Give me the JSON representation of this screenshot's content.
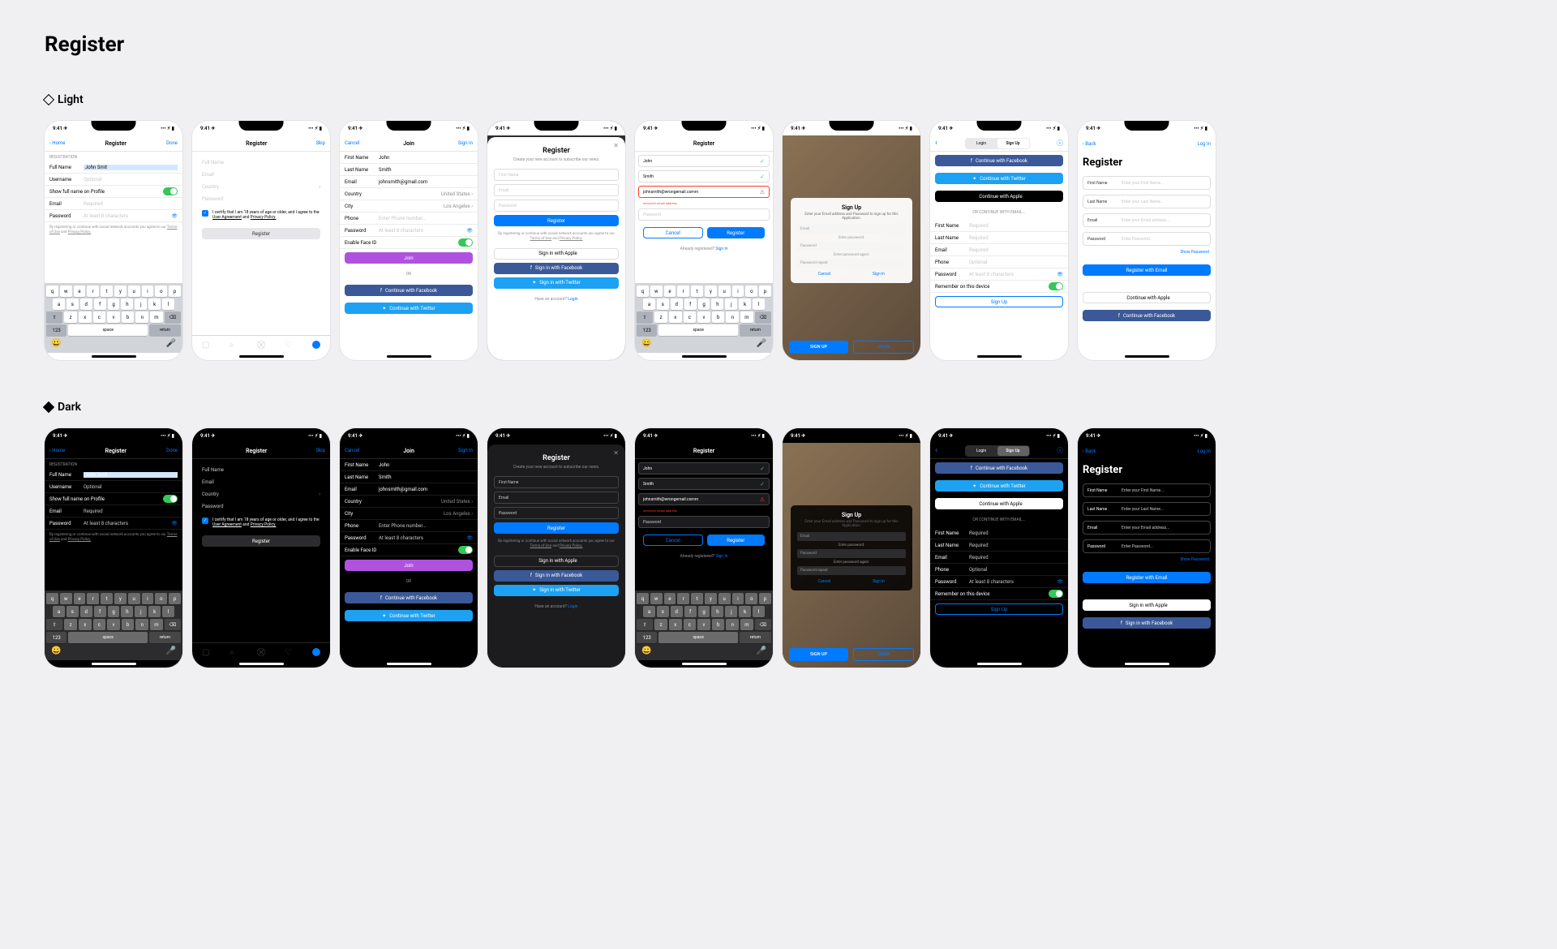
{
  "page_title": "Register",
  "variants": {
    "light": "Light",
    "dark": "Dark"
  },
  "status": {
    "time": "9:41"
  },
  "common": {
    "register": "Register",
    "done": "Done",
    "home_back": "Home",
    "skip": "Skip",
    "cancel": "Cancel",
    "signin": "Sign In",
    "join": "Join",
    "login": "Login",
    "back": "Back",
    "or": "OR",
    "signup": "Sign Up",
    "space": "space",
    "return": "return",
    "abc123": "123"
  },
  "s1": {
    "section": "REGISTRATION",
    "full_name_label": "Full Name",
    "full_name_value": "John Smit",
    "username_label": "Username",
    "username_ph": "Optional",
    "show_profile": "Show full name on Profile",
    "email_label": "Email",
    "email_ph": "Required",
    "password_label": "Password",
    "password_ph": "At least 8 characters",
    "disclaimer": "By registering or continue with social network accounts you agree to our ",
    "terms": "Terms of Use",
    "and": " and ",
    "privacy": "Privacy Policy."
  },
  "s2": {
    "full_name": "Full Name",
    "email": "Email",
    "country": "Country",
    "password": "Password",
    "cert": "I certify that I am 18 years of age or older, and I agree to the ",
    "ua": "User Agreement",
    "and": " and ",
    "pp": "Privacy Policy.",
    "register_btn": "Register"
  },
  "s3": {
    "fn_label": "First Name",
    "fn_value": "John",
    "ln_label": "Last Name",
    "ln_value": "Smith",
    "email_label": "Email",
    "email_value": "johnsmith@gmail.com",
    "country_label": "Country",
    "country_value": "United States",
    "city_label": "City",
    "city_value": "Los Angeles",
    "phone_label": "Phone",
    "phone_ph": "Enter Phone number...",
    "pw_label": "Password",
    "pw_ph": "At least 8 characters",
    "faceid": "Enable Face ID",
    "join_btn": "Join",
    "or": "OR",
    "fb": "Continue with Facebook",
    "tw": "Continue with Twitter"
  },
  "s4": {
    "title": "Register",
    "sub": "Create your new account to subscribe our news.",
    "fn_ph": "First Name",
    "email_ph": "Email",
    "pw_ph": "Password",
    "register_btn": "Register",
    "disclaimer": "By registering or continue with social network accounts you agree to our ",
    "terms": "Terms of Use",
    "and": " and ",
    "privacy": "Privacy Policy.",
    "apple": "Sign in with Apple",
    "fb": "Sign in with Facebook",
    "tw": "Sign in with Twitter",
    "have_account": "Have an account? ",
    "login": "Login"
  },
  "s5": {
    "fn_value": "John",
    "ln_value": "Smith",
    "email_value": "johnsmith@wrongemail.comm",
    "email_error": "Incorrect email address",
    "pw_ph": "Password",
    "cancel": "Cancel",
    "register": "Register",
    "already": "Already registered? ",
    "signin": "Sign In"
  },
  "s6": {
    "title": "Sign Up",
    "sub": "Enter your Email address and Password to sign up for this Application.",
    "email_ph": "Email",
    "enter_pw": "Enter password:",
    "pw_ph": "Password",
    "enter_again": "Enter password again:",
    "pw2_ph": "Password repeat",
    "cancel": "Cancel",
    "signin": "Sign In",
    "signup": "SIGN UP",
    "login": "LOGIN"
  },
  "s7": {
    "seg_login": "Login",
    "seg_signup": "Sign Up",
    "fb": "Continue with Facebook",
    "tw": "Continue with Twitter",
    "apple": "Continue with Apple",
    "or_email": "OR CONTINUE WITH EMAIL...",
    "fn_label": "First Name",
    "ln_label": "Last Name",
    "email_label": "Email",
    "phone_label": "Phone",
    "pw_label": "Password",
    "required": "Required",
    "optional": "Optional",
    "pw_ph": "At least 8 characters",
    "remember": "Remember on this device",
    "signup_btn": "Sign Up"
  },
  "s8": {
    "back": "Back",
    "login": "Log In",
    "title": "Register",
    "fn_label": "First Name",
    "fn_ph": "Enter your First Name...",
    "ln_label": "Last Name",
    "ln_ph": "Enter your Last Name...",
    "email_label": "Email",
    "email_ph": "Enter your Email address...",
    "pw_label": "Password",
    "pw_ph": "Enter Password...",
    "show_pw": "Show Password",
    "register_email": "Register with Email",
    "apple": "Continue with Apple",
    "fb": "Continue with Facebook",
    "apple_dark": "Sign in with Apple",
    "fb_dark": "Sign in with Facebook"
  },
  "keyboard": {
    "row1": [
      "q",
      "w",
      "e",
      "r",
      "t",
      "y",
      "u",
      "i",
      "o",
      "p"
    ],
    "row2": [
      "a",
      "s",
      "d",
      "f",
      "g",
      "h",
      "j",
      "k",
      "l"
    ],
    "row3": [
      "z",
      "x",
      "c",
      "v",
      "b",
      "n",
      "m"
    ]
  }
}
